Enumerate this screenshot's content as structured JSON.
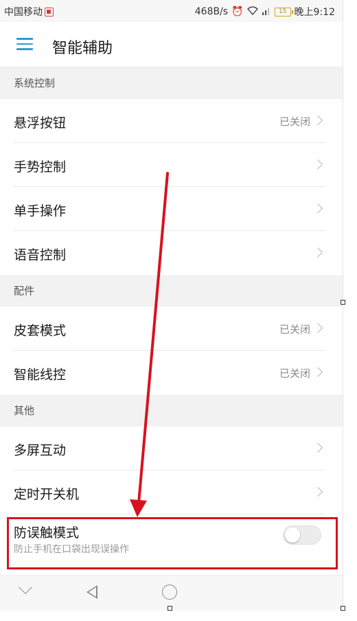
{
  "status_bar": {
    "carrier": "中国移动",
    "net_speed": "468B/s",
    "battery_level": "15",
    "time": "晚上9:12"
  },
  "header": {
    "title": "智能辅助"
  },
  "sections": [
    {
      "header": "系统控制",
      "rows": [
        {
          "label": "悬浮按钮",
          "value": "已关闭"
        },
        {
          "label": "手势控制",
          "value": ""
        },
        {
          "label": "单手操作",
          "value": ""
        },
        {
          "label": "语音控制",
          "value": ""
        }
      ]
    },
    {
      "header": "配件",
      "rows": [
        {
          "label": "皮套模式",
          "value": "已关闭"
        },
        {
          "label": "智能线控",
          "value": "已关闭"
        }
      ]
    },
    {
      "header": "其他",
      "rows": [
        {
          "label": "多屏互动",
          "value": ""
        },
        {
          "label": "定时开关机",
          "value": ""
        }
      ]
    }
  ],
  "anti_touch": {
    "label": "防误触模式",
    "description": "防止手机在口袋出现误操作",
    "enabled": false
  },
  "colors": {
    "accent": "#2c9cd5",
    "highlight": "#d8121d"
  }
}
